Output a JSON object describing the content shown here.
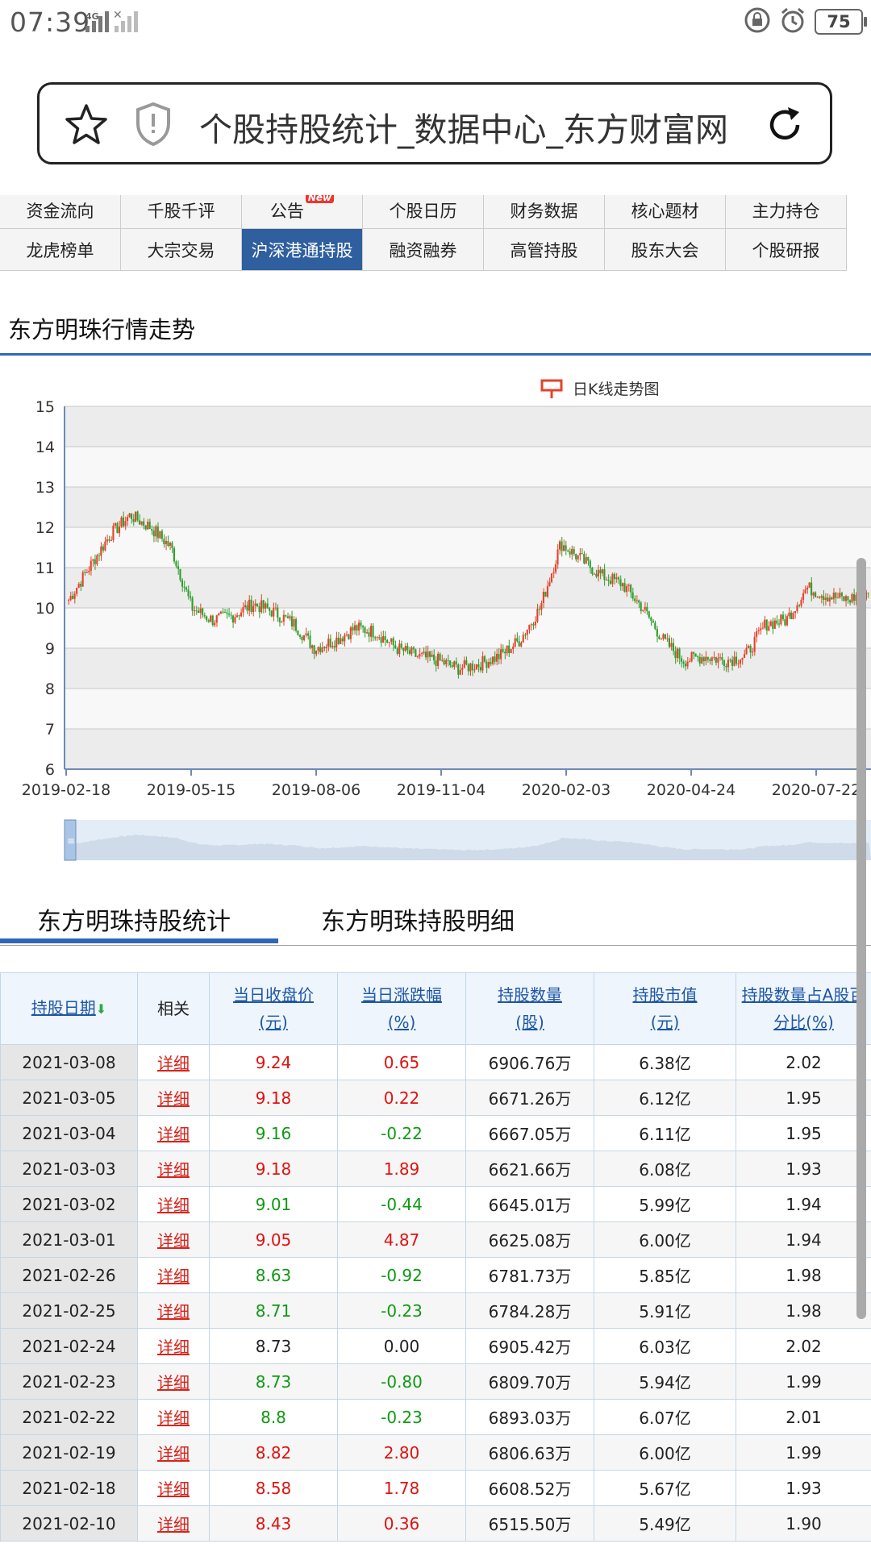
{
  "status": {
    "time": "07:39",
    "net": "4G",
    "battery": "75"
  },
  "url_bar": {
    "title": "个股持股统计_数据中心_东方财富网"
  },
  "nav": {
    "row1": [
      "资金流向",
      "千股千评",
      "公告",
      "个股日历",
      "财务数据",
      "核心题材",
      "主力持仓"
    ],
    "row1_badge": "New",
    "row2": [
      "龙虎榜单",
      "大宗交易",
      "沪深港通持股",
      "融资融券",
      "高管持股",
      "股东大会",
      "个股研报"
    ],
    "active": "沪深港通持股"
  },
  "section_title": "东方明珠行情走势",
  "chart_data": {
    "type": "candlestick",
    "title": "",
    "legend": "日K线走势图",
    "legend_position": "top-center",
    "y_ticks": [
      "15",
      "14",
      "13",
      "12",
      "11",
      "10",
      "9",
      "8",
      "7",
      "6"
    ],
    "ylim": [
      6,
      15
    ],
    "x_ticks": [
      "2019-02-18",
      "2019-05-15",
      "2019-08-06",
      "2019-11-04",
      "2020-02-03",
      "2020-04-24",
      "2020-07-22"
    ],
    "grid": true,
    "up_color": "#e5432b",
    "down_color": "#2ca02c",
    "x": [
      "2019-02-18",
      "2019-03-01",
      "2019-03-15",
      "2019-03-29",
      "2019-04-10",
      "2019-04-25",
      "2019-05-10",
      "2019-05-24",
      "2019-06-10",
      "2019-06-25",
      "2019-07-10",
      "2019-07-25",
      "2019-08-06",
      "2019-08-20",
      "2019-09-03",
      "2019-09-20",
      "2019-10-10",
      "2019-10-25",
      "2019-11-04",
      "2019-11-18",
      "2019-12-02",
      "2019-12-16",
      "2019-12-30",
      "2020-01-15",
      "2020-02-03",
      "2020-02-12",
      "2020-02-20",
      "2020-03-03",
      "2020-03-17",
      "2020-03-31",
      "2020-04-14",
      "2020-04-24",
      "2020-05-11",
      "2020-05-25",
      "2020-06-10",
      "2020-06-24",
      "2020-07-09",
      "2020-07-22",
      "2020-08-05",
      "2020-08-14"
    ],
    "close": [
      10.2,
      11.0,
      11.8,
      12.3,
      12.0,
      11.5,
      10.0,
      9.7,
      9.8,
      10.1,
      9.9,
      9.6,
      9.0,
      9.2,
      9.5,
      9.4,
      9.0,
      8.8,
      8.7,
      8.5,
      8.6,
      8.8,
      9.2,
      10.0,
      11.6,
      11.2,
      10.8,
      10.6,
      10.0,
      9.2,
      8.7,
      8.8,
      8.7,
      8.8,
      9.6,
      9.7,
      10.5,
      10.3,
      10.2,
      10.4
    ],
    "volume_navigator": true
  },
  "tabs": [
    "东方明珠持股统计",
    "东方明珠持股明细"
  ],
  "table": {
    "headers": [
      [
        "持股日期"
      ],
      [
        "相关"
      ],
      [
        "当日收盘价",
        "(元)"
      ],
      [
        "当日涨跌幅",
        "(%)"
      ],
      [
        "持股数量",
        "(股)"
      ],
      [
        "持股市值",
        "(元)"
      ],
      [
        "持股数量占A股百",
        "分比(%)"
      ]
    ],
    "rows": [
      [
        "2021-03-08",
        "详细",
        "9.24",
        "0.65",
        "6906.76万",
        "6.38亿",
        "2.02"
      ],
      [
        "2021-03-05",
        "详细",
        "9.18",
        "0.22",
        "6671.26万",
        "6.12亿",
        "1.95"
      ],
      [
        "2021-03-04",
        "详细",
        "9.16",
        "-0.22",
        "6667.05万",
        "6.11亿",
        "1.95"
      ],
      [
        "2021-03-03",
        "详细",
        "9.18",
        "1.89",
        "6621.66万",
        "6.08亿",
        "1.93"
      ],
      [
        "2021-03-02",
        "详细",
        "9.01",
        "-0.44",
        "6645.01万",
        "5.99亿",
        "1.94"
      ],
      [
        "2021-03-01",
        "详细",
        "9.05",
        "4.87",
        "6625.08万",
        "6.00亿",
        "1.94"
      ],
      [
        "2021-02-26",
        "详细",
        "8.63",
        "-0.92",
        "6781.73万",
        "5.85亿",
        "1.98"
      ],
      [
        "2021-02-25",
        "详细",
        "8.71",
        "-0.23",
        "6784.28万",
        "5.91亿",
        "1.98"
      ],
      [
        "2021-02-24",
        "详细",
        "8.73",
        "0.00",
        "6905.42万",
        "6.03亿",
        "2.02"
      ],
      [
        "2021-02-23",
        "详细",
        "8.73",
        "-0.80",
        "6809.70万",
        "5.94亿",
        "1.99"
      ],
      [
        "2021-02-22",
        "详细",
        "8.8",
        "-0.23",
        "6893.03万",
        "6.07亿",
        "2.01"
      ],
      [
        "2021-02-19",
        "详细",
        "8.82",
        "2.80",
        "6806.63万",
        "6.00亿",
        "1.99"
      ],
      [
        "2021-02-18",
        "详细",
        "8.58",
        "1.78",
        "6608.52万",
        "5.67亿",
        "1.93"
      ],
      [
        "2021-02-10",
        "详细",
        "8.43",
        "0.36",
        "6515.50万",
        "5.49亿",
        "1.90"
      ]
    ]
  }
}
